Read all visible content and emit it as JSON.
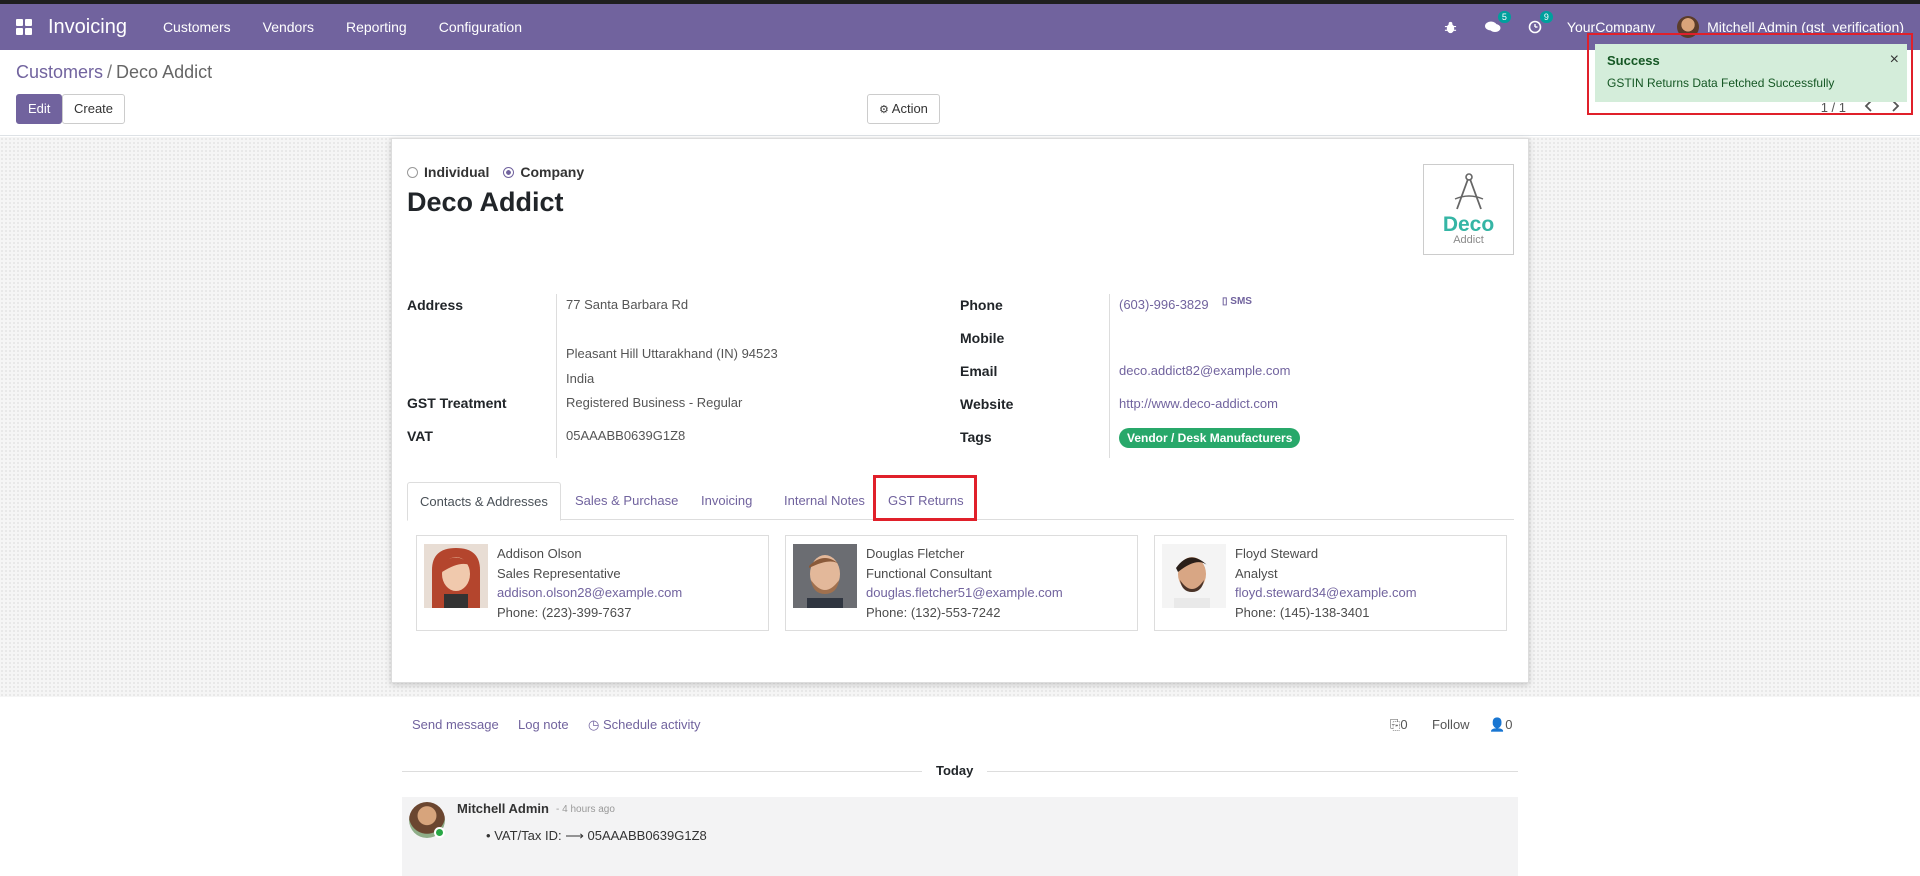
{
  "navbar": {
    "app_name": "Invoicing",
    "menu": [
      "Customers",
      "Vendors",
      "Reporting",
      "Configuration"
    ],
    "messages_count": "5",
    "activities_count": "9",
    "company": "YourCompany",
    "user": "Mitchell Admin (gst_verification)"
  },
  "breadcrumb": {
    "parent": "Customers",
    "separator": "/",
    "current": "Deco Addict"
  },
  "buttons": {
    "edit": "Edit",
    "create": "Create",
    "action": "Action"
  },
  "pager": {
    "value": "1 / 1"
  },
  "notification": {
    "title": "Success",
    "message": "GSTIN Returns Data Fetched Successfully",
    "close": "×"
  },
  "form": {
    "type_options": {
      "individual": "Individual",
      "company": "Company"
    },
    "name": "Deco Addict",
    "logo": {
      "title": "Deco",
      "subtitle": "Addict"
    },
    "labels": {
      "address": "Address",
      "gst_treatment": "GST Treatment",
      "vat": "VAT",
      "phone": "Phone",
      "mobile": "Mobile",
      "email": "Email",
      "website": "Website",
      "tags": "Tags"
    },
    "values": {
      "street": "77 Santa Barbara Rd",
      "city_line": "Pleasant Hill  Uttarakhand (IN)  94523",
      "country": "India",
      "gst_treatment": "Registered Business - Regular",
      "vat": "05AAABB0639G1Z8",
      "phone": "(603)-996-3829",
      "sms": "SMS",
      "email": "deco.addict82@example.com",
      "website": "http://www.deco-addict.com",
      "tag": "Vendor / Desk Manufacturers"
    }
  },
  "tabs": [
    "Contacts & Addresses",
    "Sales & Purchase",
    "Invoicing",
    "Internal Notes",
    "GST Returns"
  ],
  "contacts": [
    {
      "name": "Addison Olson",
      "title": "Sales Representative",
      "email": "addison.olson28@example.com",
      "phone": "Phone: (223)-399-7637"
    },
    {
      "name": "Douglas Fletcher",
      "title": "Functional Consultant",
      "email": "douglas.fletcher51@example.com",
      "phone": "Phone: (132)-553-7242"
    },
    {
      "name": "Floyd Steward",
      "title": "Analyst",
      "email": "floyd.steward34@example.com",
      "phone": "Phone: (145)-138-3401"
    }
  ],
  "chatter": {
    "send_message": "Send message",
    "log_note": "Log note",
    "schedule_activity": "Schedule activity",
    "attachments": "0",
    "follow": "Follow",
    "followers": "0",
    "today": "Today",
    "message": {
      "author": "Mitchell Admin",
      "time": "- 4 hours ago",
      "field": "VAT/Tax ID:",
      "arrow": "⟶",
      "new_value": "05AAABB0639G1Z8"
    }
  },
  "colors": {
    "brand": "#71639e",
    "success_bg": "#d4edda",
    "tag": "#28a86a",
    "highlight": "#e0202a"
  }
}
